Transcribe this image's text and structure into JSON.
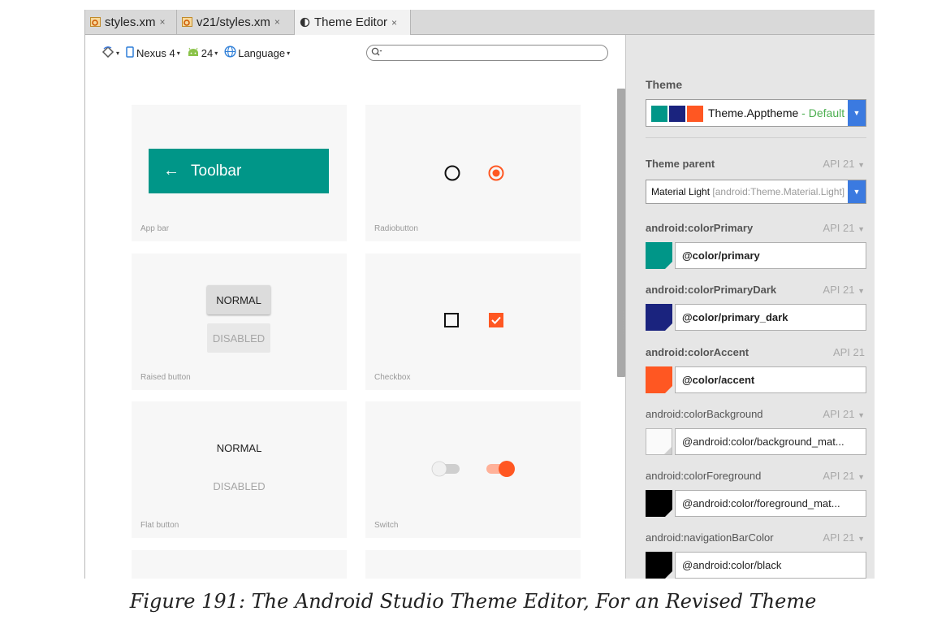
{
  "tabs": [
    {
      "label": "styles.xm",
      "close": "×"
    },
    {
      "label": "v21/styles.xm",
      "close": "×"
    },
    {
      "label": "Theme Editor",
      "close": "×"
    }
  ],
  "toolbar": {
    "device": "Nexus 4",
    "api_level": "24",
    "language": "Language",
    "search_placeholder": ""
  },
  "preview_cards": {
    "app_bar": {
      "toolbar_title": "Toolbar",
      "label": "App bar"
    },
    "radio": {
      "label": "Radiobutton"
    },
    "raised": {
      "normal": "NORMAL",
      "disabled": "DISABLED",
      "label": "Raised button"
    },
    "checkbox": {
      "label": "Checkbox"
    },
    "flat": {
      "normal": "NORMAL",
      "disabled": "DISABLED",
      "label": "Flat button"
    },
    "switch": {
      "label": "Switch"
    }
  },
  "panel": {
    "theme_title": "Theme",
    "theme_name": "Theme.Apptheme",
    "theme_dash": " - ",
    "theme_default": "Default",
    "parent": {
      "label": "Theme parent",
      "api": "API 21",
      "value": "Material Light",
      "hint": "[android:Theme.Material.Light]"
    },
    "attributes": [
      {
        "name": "android:colorPrimary",
        "api": "API 21",
        "value": "@color/primary",
        "color": "#009688",
        "bold": true
      },
      {
        "name": "android:colorPrimaryDark",
        "api": "API 21",
        "value": "@color/primary_dark",
        "color": "#1a237e",
        "bold": true
      },
      {
        "name": "android:colorAccent",
        "api": "API 21",
        "value": "@color/accent",
        "color": "#ff5722",
        "bold": true
      },
      {
        "name": "android:colorBackground",
        "api": "API 21",
        "value": "@android:color/background_mat...",
        "color": "#fafafa",
        "bold": false
      },
      {
        "name": "android:colorForeground",
        "api": "API 21",
        "value": "@android:color/foreground_mat...",
        "color": "#000000",
        "bold": false
      },
      {
        "name": "android:navigationBarColor",
        "api": "API 21",
        "value": "@android:color/black",
        "color": "#000000",
        "bold": false
      }
    ]
  },
  "colors": {
    "primary": "#009688",
    "primary_dark": "#1a237e",
    "accent": "#ff5722",
    "dropdown": "#3b7ae0"
  },
  "caption": "Figure 191: The Android Studio Theme Editor, For an Revised Theme"
}
